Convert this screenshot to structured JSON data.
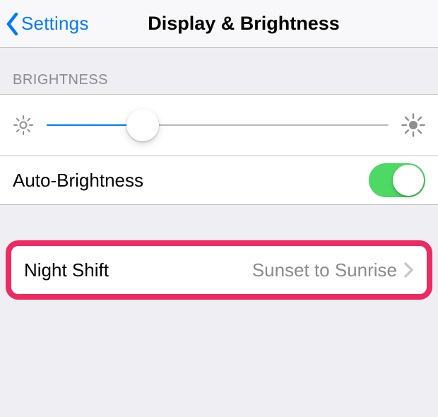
{
  "nav": {
    "back_label": "Settings",
    "title": "Display & Brightness"
  },
  "brightness_section_header": "BRIGHTNESS",
  "brightness_slider": {
    "percent": 28
  },
  "auto_brightness": {
    "label": "Auto-Brightness",
    "on": true
  },
  "night_shift": {
    "label": "Night Shift",
    "value": "Sunset to Sunrise"
  }
}
